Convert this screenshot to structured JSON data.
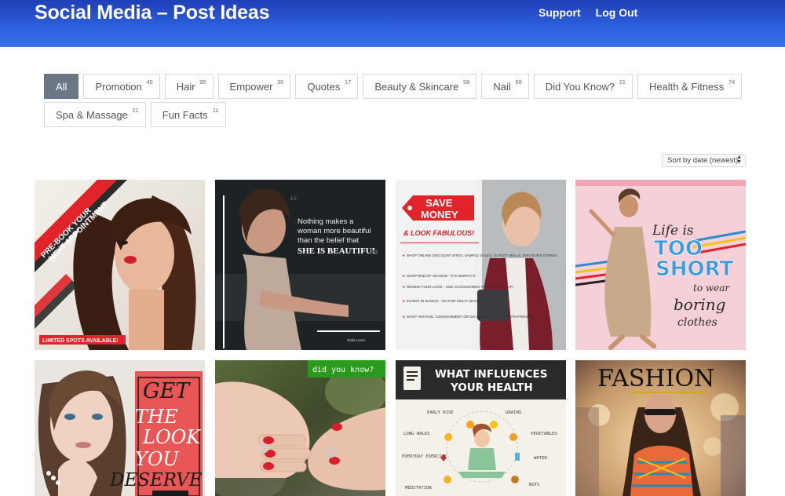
{
  "header": {
    "title": "Social Media – Post Ideas",
    "nav": {
      "support": "Support",
      "logout": "Log Out"
    }
  },
  "filters": [
    {
      "label": "All",
      "count": "",
      "active": true
    },
    {
      "label": "Promotion",
      "count": "45"
    },
    {
      "label": "Hair",
      "count": "95"
    },
    {
      "label": "Empower",
      "count": "30"
    },
    {
      "label": "Quotes",
      "count": "17"
    },
    {
      "label": "Beauty & Skincare",
      "count": "58"
    },
    {
      "label": "Nail",
      "count": "58"
    },
    {
      "label": "Did You Know?",
      "count": "21"
    },
    {
      "label": "Health & Fitness",
      "count": "74"
    },
    {
      "label": "Spa & Massage",
      "count": "21"
    },
    {
      "label": "Fun Facts",
      "count": "11"
    }
  ],
  "sort": {
    "selected": "Sort by date (newest)"
  },
  "posts": {
    "p1": {
      "banner": "LIMITED SPOTS AVAILABLE!",
      "ribbon_1": "PRE-BOOK YOUR",
      "ribbon_2": "NEXT APPOINTMENT"
    },
    "p2": {
      "q1": "Nothing makes a",
      "q2": "woman more beautiful",
      "q3": "than the belief that",
      "q4": "SHE IS BEAUTIFUL",
      "author": "Sofia Loren"
    },
    "p3": {
      "t1": "SAVE",
      "t2": "MONEY",
      "t3": "& LOOK FABULOUS!",
      "tips": [
        "SHOP ONLINE DISCOUNT SITES, SAMPLE SALES, OUTLET MALLS, DISCOUNT STORES",
        "SHOP END OF SEASON - IT'S WORTH IT",
        "RENEW YOUR LOOK - USE ACCESSORIES TO CHANGE IT UP!",
        "INVEST IN BASICS - GO FOR MULTI-SEASONAL ITEMS",
        "SHOP VINTAGE, CONSIGNMENT OR DO CLOTHING SWAP WITH FRIENDS"
      ]
    },
    "p4": {
      "w1": "Life is",
      "w2": "TOO",
      "w3": "SHORT",
      "w4": "to wear",
      "w5": "boring",
      "w6": "clothes"
    },
    "p5": {
      "w1": "GET",
      "w2": "THE",
      "w3": "LOOK",
      "w4": "YOU",
      "w5": "DESERVE"
    },
    "p6": {
      "banner": "did you know?"
    },
    "p7": {
      "title_1": "WHAT INFLUENCES",
      "title_2": "YOUR HEALTH",
      "factors": [
        "EARLY RISE",
        "GRAINS",
        "LONG WALKS",
        "VEGETABLES",
        "EVERYDAY EXERCISE",
        "WATER",
        "MEDITATION",
        "NUTS"
      ]
    },
    "p8": {
      "title": "FASHION"
    }
  },
  "colors": {
    "accent": "#2f63e0",
    "active_chip": "#6b7784",
    "red": "#e0242a"
  }
}
